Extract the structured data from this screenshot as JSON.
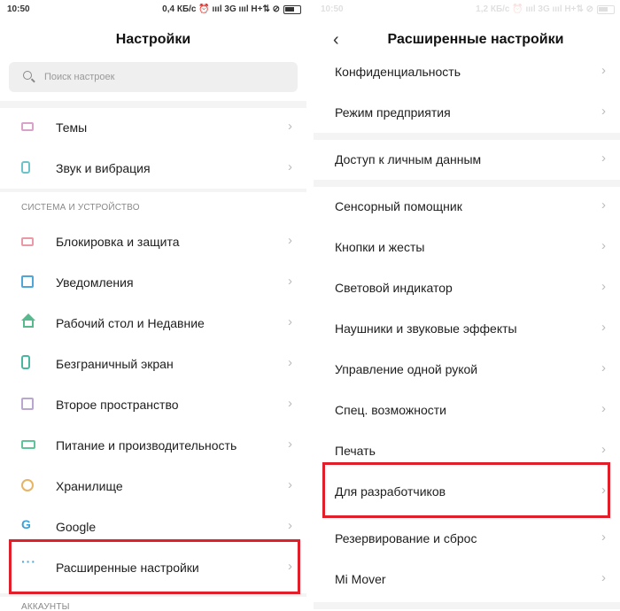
{
  "left": {
    "status": {
      "time": "10:50",
      "icons": "0,4 КБ/с ⏰ ıııl 3G ıııl H+⇅ ⊘",
      "battery": "34"
    },
    "title": "Настройки",
    "search": {
      "placeholder": "Поиск настроек",
      "icon": "search-icon"
    },
    "items_top": [
      {
        "label": "Темы",
        "icon": "theme-icon",
        "color": "#d9a2c9"
      },
      {
        "label": "Звук и вибрация",
        "icon": "sound-icon",
        "color": "#6cc4c8"
      }
    ],
    "section_system": "СИСТЕМА И УСТРОЙСТВО",
    "items_system": [
      {
        "label": "Блокировка и защита",
        "icon": "lock-icon"
      },
      {
        "label": "Уведомления",
        "icon": "notification-icon"
      },
      {
        "label": "Рабочий стол и Недавние",
        "icon": "home-icon"
      },
      {
        "label": "Безграничный экран",
        "icon": "screen-icon"
      },
      {
        "label": "Второе пространство",
        "icon": "second-space-icon"
      },
      {
        "label": "Питание и производительность",
        "icon": "battery-icon"
      },
      {
        "label": "Хранилище",
        "icon": "storage-icon"
      },
      {
        "label": "Google",
        "icon": "google-icon",
        "glyph": "G"
      },
      {
        "label": "Расширенные настройки",
        "icon": "more-icon",
        "glyph": "···"
      }
    ],
    "section_accounts": "АККАУНТЫ"
  },
  "right": {
    "status": {
      "time": "10:50",
      "icons": "1,2 КБ/с ⏰ ıııl 3G ıııl H+⇅ ⊘",
      "battery": "34"
    },
    "title": "Расширенные настройки",
    "back_icon": "back-chevron-icon",
    "items": [
      "Конфиденциальность",
      "Режим предприятия",
      "Доступ к личным данным",
      "Сенсорный помощник",
      "Кнопки и жесты",
      "Световой индикатор",
      "Наушники и звуковые эффекты",
      "Управление одной рукой",
      "Спец. возможности",
      "Печать",
      "Для разработчиков",
      "Резервирование и сброс",
      "Mi Mover"
    ]
  },
  "highlight_color": "#e01f2a"
}
